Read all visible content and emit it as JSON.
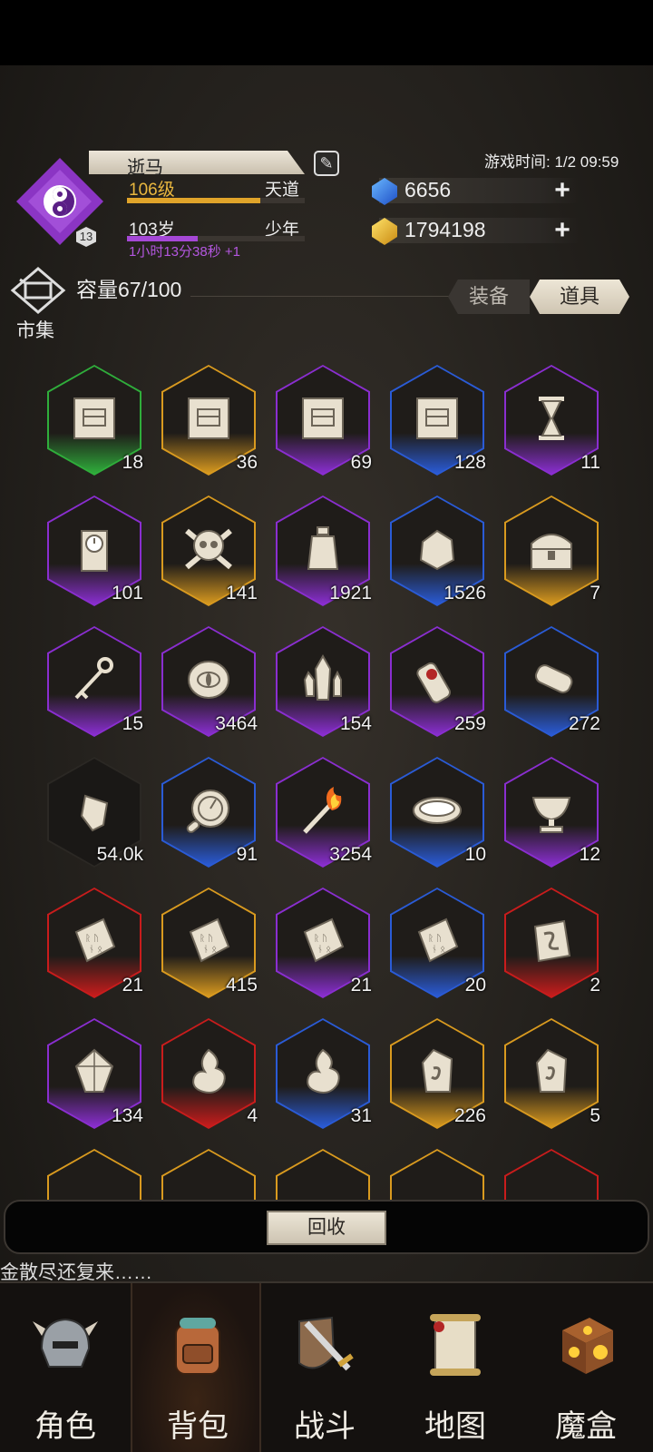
{
  "player": {
    "name": "逝马",
    "level": "106级",
    "realm": "天道",
    "level_progress": 0.75,
    "age": "103岁",
    "age_stage": "少年",
    "age_progress": 0.4,
    "timer": "1小时13分38秒 +1",
    "avatar_badge": "13"
  },
  "game_time": "游戏时间: 1/2 09:59",
  "resources": {
    "gems": "6656",
    "gold": "1794198"
  },
  "market_label": "市集",
  "capacity": "容量67/100",
  "tabs": {
    "equip": "装备",
    "items": "道具"
  },
  "items": [
    {
      "icon": "map-scroll-icon",
      "count": "18",
      "rarity": "green"
    },
    {
      "icon": "map-scroll-icon",
      "count": "36",
      "rarity": "gold"
    },
    {
      "icon": "map-scroll-icon",
      "count": "69",
      "rarity": "purple"
    },
    {
      "icon": "map-scroll-icon",
      "count": "128",
      "rarity": "blue"
    },
    {
      "icon": "hourglass-icon",
      "count": "11",
      "rarity": "purple"
    },
    {
      "icon": "clock-icon",
      "count": "101",
      "rarity": "purple"
    },
    {
      "icon": "skull-icon",
      "count": "141",
      "rarity": "gold"
    },
    {
      "icon": "sand-jar-icon",
      "count": "1921",
      "rarity": "purple"
    },
    {
      "icon": "stone-icon",
      "count": "1526",
      "rarity": "blue"
    },
    {
      "icon": "treasure-chest-icon",
      "count": "7",
      "rarity": "gold"
    },
    {
      "icon": "key-icon",
      "count": "15",
      "rarity": "purple"
    },
    {
      "icon": "eye-stone-icon",
      "count": "3464",
      "rarity": "purple"
    },
    {
      "icon": "crystal-icon",
      "count": "154",
      "rarity": "purple"
    },
    {
      "icon": "sealed-scroll-icon",
      "count": "259",
      "rarity": "purple"
    },
    {
      "icon": "scroll-icon",
      "count": "272",
      "rarity": "blue"
    },
    {
      "icon": "shard-icon",
      "count": "54.0k",
      "rarity": "none"
    },
    {
      "icon": "compass-icon",
      "count": "91",
      "rarity": "blue"
    },
    {
      "icon": "torch-icon",
      "count": "3254",
      "rarity": "purple"
    },
    {
      "icon": "bowl-icon",
      "count": "10",
      "rarity": "blue"
    },
    {
      "icon": "chalice-icon",
      "count": "12",
      "rarity": "purple"
    },
    {
      "icon": "rune-tablet-icon",
      "count": "21",
      "rarity": "red"
    },
    {
      "icon": "rune-tablet-icon",
      "count": "415",
      "rarity": "gold"
    },
    {
      "icon": "rune-tablet-icon",
      "count": "21",
      "rarity": "purple"
    },
    {
      "icon": "rune-tablet-icon",
      "count": "20",
      "rarity": "blue"
    },
    {
      "icon": "rune-block-icon",
      "count": "2",
      "rarity": "red"
    },
    {
      "icon": "gem-stone-icon",
      "count": "134",
      "rarity": "purple"
    },
    {
      "icon": "spirit-flame-icon",
      "count": "4",
      "rarity": "red"
    },
    {
      "icon": "spirit-flame-icon",
      "count": "31",
      "rarity": "blue"
    },
    {
      "icon": "rune-crystal-icon",
      "count": "226",
      "rarity": "gold"
    },
    {
      "icon": "rune-crystal-icon",
      "count": "5",
      "rarity": "gold"
    }
  ],
  "recycle_label": "回收",
  "ticker": "金散尽还复来……",
  "nav": [
    {
      "icon": "helmet-icon",
      "label": "角色"
    },
    {
      "icon": "backpack-icon",
      "label": "背包"
    },
    {
      "icon": "sword-shield-icon",
      "label": "战斗"
    },
    {
      "icon": "map-scroll-icon",
      "label": "地图"
    },
    {
      "icon": "magic-box-icon",
      "label": "魔盒"
    }
  ],
  "colors": {
    "green": "#2fae3b",
    "gold": "#d99a1f",
    "purple": "#8a2ed0",
    "blue": "#2a5bd6",
    "red": "#c91c1c",
    "none": "#262320",
    "level_bar": "#e0a42a",
    "age_bar": "#a548d6"
  }
}
